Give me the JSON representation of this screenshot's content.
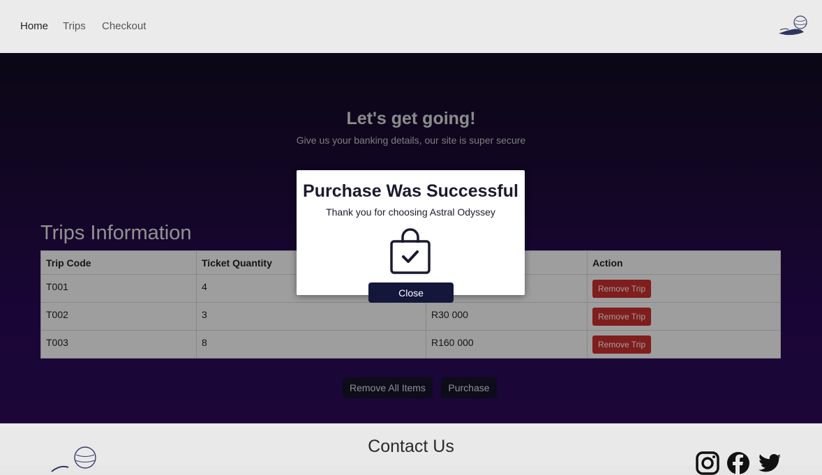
{
  "nav": {
    "links": [
      {
        "label": "Home"
      },
      {
        "label": "Trips"
      },
      {
        "label": "Checkout"
      }
    ]
  },
  "hero": {
    "title": "Let's get going!",
    "subtitle": "Give us your banking details, our site is super secure"
  },
  "trips": {
    "title": "Trips Information",
    "headers": [
      "Trip Code",
      "Ticket Quantity",
      "",
      "Action"
    ],
    "rows": [
      {
        "code": "T001",
        "qty": "4",
        "price": "",
        "action": "Remove Trip"
      },
      {
        "code": "T002",
        "qty": "3",
        "price": "R30 000",
        "action": "Remove Trip"
      },
      {
        "code": "T003",
        "qty": "8",
        "price": "R160 000",
        "action": "Remove Trip"
      }
    ],
    "remove_all_label": "Remove All Items",
    "purchase_label": "Purchase"
  },
  "modal": {
    "title": "Purchase Was Successful",
    "text": "Thank you for choosing Astral Odyssey",
    "icon": "shopping-bag-check-icon",
    "close_label": "Close"
  },
  "footer": {
    "title": "Contact Us",
    "icons": [
      "instagram-icon",
      "facebook-icon",
      "twitter-icon"
    ]
  },
  "colors": {
    "remove": "#cf2e2e",
    "dark_button": "#14163a",
    "hero_bg": "#2a0858"
  }
}
